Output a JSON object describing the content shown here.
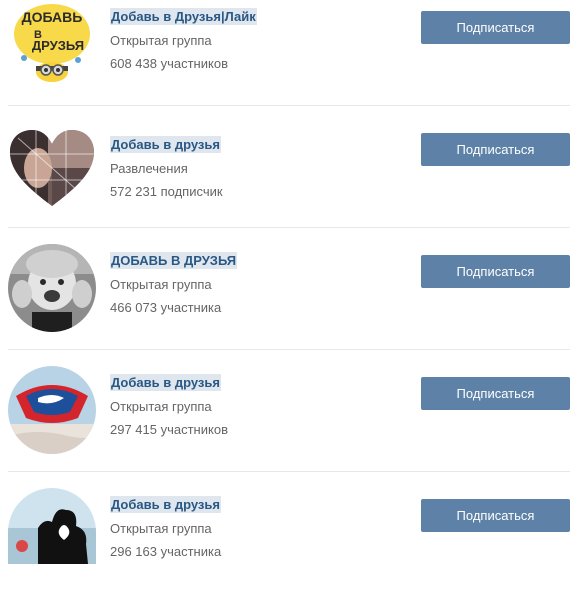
{
  "groups": [
    {
      "name": "Добавь в Друзья|Лайк",
      "category": "Открытая группа",
      "count": "608 438 участников",
      "button_label": "Подписаться",
      "avatar_text": "ДОБАВЬ В ДРУЗЬЯ"
    },
    {
      "name": "Добавь в друзья",
      "category": "Развлечения",
      "count": "572 231 подписчик",
      "button_label": "Подписаться"
    },
    {
      "name": "ДОБАВЬ В ДРУЗЬЯ",
      "category": "Открытая группа",
      "count": "466 073 участника",
      "button_label": "Подписаться"
    },
    {
      "name": "Добавь в друзья",
      "category": "Открытая группа",
      "count": "297 415 участников",
      "button_label": "Подписаться"
    },
    {
      "name": "Добавь в друзья",
      "category": "Открытая группа",
      "count": "296 163 участника",
      "button_label": "Подписаться"
    }
  ],
  "colors": {
    "link": "#2a5885",
    "highlight": "#dfe6ee",
    "button": "#5e81a8",
    "meta_text": "#656565"
  }
}
